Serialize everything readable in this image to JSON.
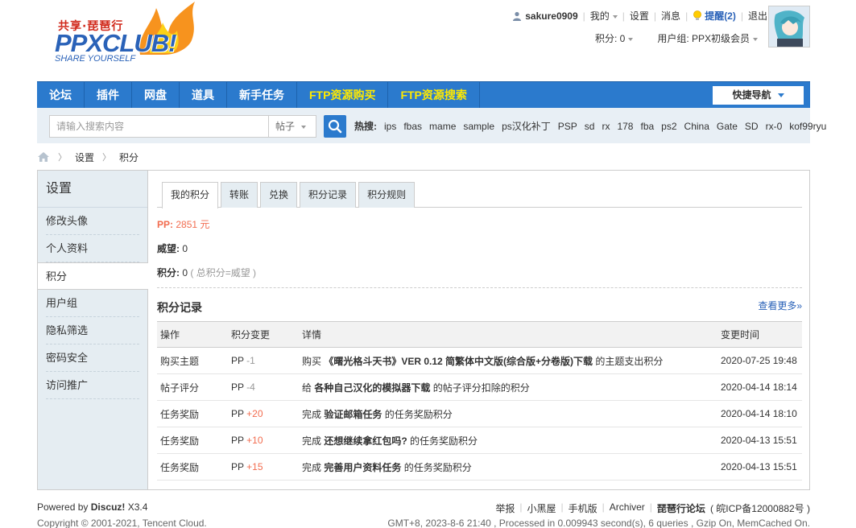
{
  "logo": {
    "cn_text": "共享·琵琶行",
    "main_text": "PPXCLUB!",
    "slogan": "SHARE YOURSELF"
  },
  "user": {
    "name": "sakure0909",
    "mine": "我的",
    "settings": "设置",
    "messages": "消息",
    "alerts": "提醒(2)",
    "logout": "退出",
    "credits": "积分: 0",
    "group": "用户组: PPX初级会员"
  },
  "nav": {
    "items": [
      "论坛",
      "插件",
      "网盘",
      "道具",
      "新手任务",
      "FTP资源购买",
      "FTP资源搜索"
    ],
    "quick_nav": "快捷导航"
  },
  "search": {
    "placeholder": "请输入搜索内容",
    "type": "帖子",
    "hot_label": "热搜:",
    "hot_terms": [
      "ips",
      "fbas",
      "mame",
      "sample",
      "ps汉化补丁",
      "PSP",
      "sd",
      "rx",
      "178",
      "fba",
      "ps2",
      "China",
      "Gate",
      "SD",
      "rx-0",
      "kof99ryu"
    ]
  },
  "breadcrumb": {
    "items": [
      "设置",
      "积分"
    ]
  },
  "sidebar": {
    "title": "设置",
    "items": [
      "修改头像",
      "个人资料",
      "积分",
      "用户组",
      "隐私筛选",
      "密码安全",
      "访问推广"
    ],
    "active_index": 2
  },
  "tabs": [
    "我的积分",
    "转账",
    "兑换",
    "积分记录",
    "积分规则"
  ],
  "credits": {
    "pp_label": "PP:",
    "pp_value": "2851 元",
    "prestige_label": "威望:",
    "prestige_value": "0",
    "total_label": "积分:",
    "total_value": "0",
    "total_note": "( 总积分=威望 )"
  },
  "records": {
    "title": "积分记录",
    "more": "查看更多»",
    "headers": [
      "操作",
      "积分变更",
      "详情",
      "变更时间"
    ],
    "rows": [
      {
        "op": "购买主题",
        "unit": "PP",
        "change": "-1",
        "pre": "购买",
        "title": "《曙光格斗天书》VER 0.12 简繁体中文版(综合版+分卷版)下载",
        "post": "的主题支出积分",
        "time": "2020-07-25 19:48"
      },
      {
        "op": "帖子评分",
        "unit": "PP",
        "change": "-4",
        "pre": "给",
        "title": "各种自己汉化的模拟器下载",
        "post": "的帖子评分扣除的积分",
        "time": "2020-04-14 18:14"
      },
      {
        "op": "任务奖励",
        "unit": "PP",
        "change": "+20",
        "pre": "完成",
        "title": "验证邮箱任务",
        "post": "的任务奖励积分",
        "time": "2020-04-14 18:10"
      },
      {
        "op": "任务奖励",
        "unit": "PP",
        "change": "+10",
        "pre": "完成",
        "title": "还想继续拿红包吗?",
        "post": "的任务奖励积分",
        "time": "2020-04-13 15:51"
      },
      {
        "op": "任务奖励",
        "unit": "PP",
        "change": "+15",
        "pre": "完成",
        "title": "完善用户资料任务",
        "post": "的任务奖励积分",
        "time": "2020-04-13 15:51"
      }
    ]
  },
  "footer": {
    "powered": "Powered by",
    "discuz": "Discuz!",
    "version": "X3.4",
    "copyright": "Copyright © 2001-2021, Tencent Cloud.",
    "links": [
      "举报",
      "小黑屋",
      "手机版",
      "Archiver"
    ],
    "site": "琵琶行论坛",
    "icp": "( 皖ICP备12000882号 )",
    "stats": "GMT+8, 2023-8-6 21:40 , Processed in 0.009943 second(s), 6 queries , Gzip On, MemCached On."
  },
  "colors": {
    "nav_bg": "#2b7acd",
    "nav_highlight": "#ffea00",
    "accent_red": "#f26c4f",
    "link_blue": "#2a62b8",
    "sidebar_bg": "#e5edf2"
  }
}
